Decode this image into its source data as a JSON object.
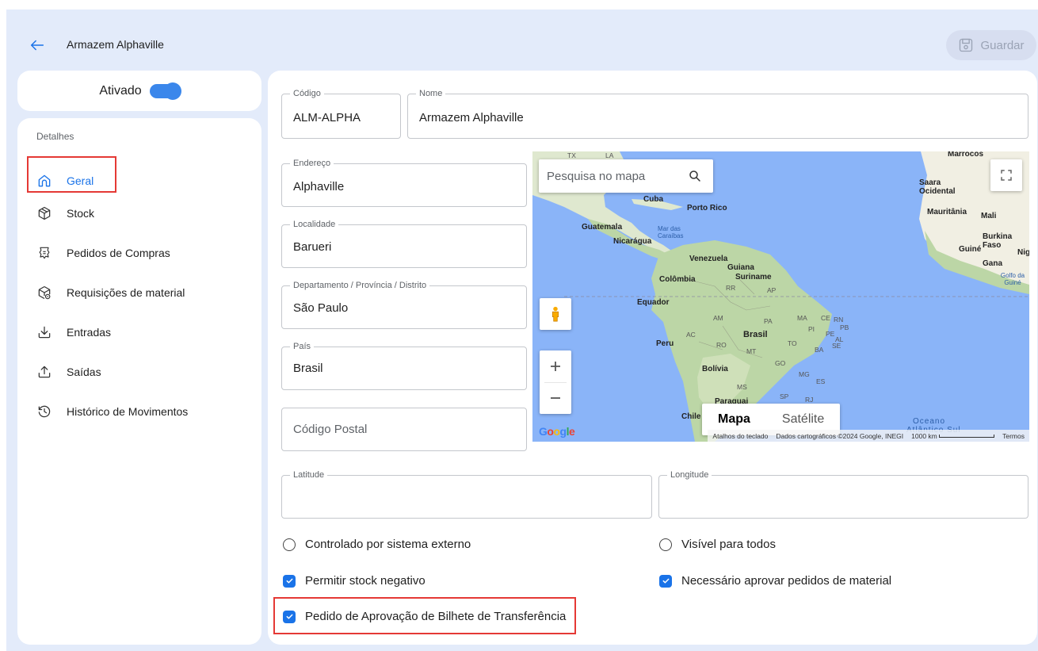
{
  "header": {
    "title": "Armazem Alphaville",
    "save_label": "Guardar"
  },
  "status": {
    "label": "Ativado",
    "enabled": true
  },
  "sidebar": {
    "section": "Detalhes",
    "items": [
      {
        "label": "Geral",
        "icon": "home-icon",
        "active": true
      },
      {
        "label": "Stock",
        "icon": "cube-icon",
        "active": false
      },
      {
        "label": "Pedidos de Compras",
        "icon": "purchase-order-icon",
        "active": false
      },
      {
        "label": "Requisições de material",
        "icon": "material-request-icon",
        "active": false
      },
      {
        "label": "Entradas",
        "icon": "download-icon",
        "active": false
      },
      {
        "label": "Saídas",
        "icon": "upload-icon",
        "active": false
      },
      {
        "label": "Histórico de Movimentos",
        "icon": "history-icon",
        "active": false
      }
    ]
  },
  "form": {
    "codigo": {
      "label": "Código",
      "value": "ALM-ALPHA"
    },
    "nome": {
      "label": "Nome",
      "value": "Armazem Alphaville"
    },
    "endereco": {
      "label": "Endereço",
      "value": "Alphaville"
    },
    "localidade": {
      "label": "Localidade",
      "value": "Barueri"
    },
    "departamento": {
      "label": "Departamento / Província / Distrito",
      "value": "São Paulo"
    },
    "pais": {
      "label": "País",
      "value": "Brasil"
    },
    "codigo_postal": {
      "placeholder": "Código Postal"
    },
    "latitude": {
      "label": "Latitude",
      "value": ""
    },
    "longitude": {
      "label": "Longitude",
      "value": ""
    }
  },
  "map": {
    "search_placeholder": "Pesquisa no mapa",
    "type_map": "Mapa",
    "type_satellite": "Satélite",
    "selected_type": "Mapa",
    "logo": "Google",
    "footer": {
      "shortcuts": "Atalhos do teclado",
      "data": "Dados cartográficos ©2024 Google, INEGI",
      "scale": "1000 km",
      "terms": "Termos"
    },
    "labels": {
      "cuba": "Cuba",
      "porto_rico": "Porto Rico",
      "guatemala": "Guatemala",
      "nicaragua": "Nicarágua",
      "mar_caraibas": "Mar das Caraíbas",
      "venezuela": "Venezuela",
      "guiana": "Guiana",
      "suriname": "Suriname",
      "colombia": "Colômbia",
      "equador": "Equador",
      "peru": "Peru",
      "brasil": "Brasil",
      "bolivia": "Bolívia",
      "paraguai": "Paraguai",
      "chile": "Chile",
      "saara_ocidental": "Saara Ocidental",
      "mauritania": "Mauritânia",
      "mali": "Mali",
      "burkina_faso": "Burkina Faso",
      "guine": "Guiné",
      "gana": "Gana",
      "golfo_guine": "Golfo da Guiné",
      "marrocos": "Marrocos",
      "oceano": "Oceano",
      "atlantico_sul": "Atlântico Sul",
      "ni": "Nig",
      "rr": "RR",
      "ap": "AP",
      "am": "AM",
      "pa": "PA",
      "ma": "MA",
      "ce": "CE",
      "rn": "RN",
      "pi": "PI",
      "pb": "PB",
      "pe": "PE",
      "al": "AL",
      "ac": "AC",
      "ro": "RO",
      "to": "TO",
      "mt": "MT",
      "ba": "BA",
      "se": "SE",
      "go": "GO",
      "mg": "MG",
      "ms": "MS",
      "es": "ES",
      "sp": "SP",
      "rj": "RJ",
      "tx": "TX",
      "la": "LA"
    }
  },
  "options": {
    "externo": {
      "label": "Controlado por sistema externo",
      "checked": false
    },
    "visivel": {
      "label": "Visível para todos",
      "checked": false
    },
    "stock_negativo": {
      "label": "Permitir stock negativo",
      "checked": true
    },
    "aprovar_pedidos": {
      "label": "Necessário aprovar pedidos de material",
      "checked": true
    },
    "aprovacao_bilhete": {
      "label": "Pedido de Aprovação de Bilhete de Transferência",
      "checked": true
    }
  },
  "colors": {
    "accent": "#1a73e8",
    "background": "#e3ebfa",
    "highlight": "#e53935"
  }
}
